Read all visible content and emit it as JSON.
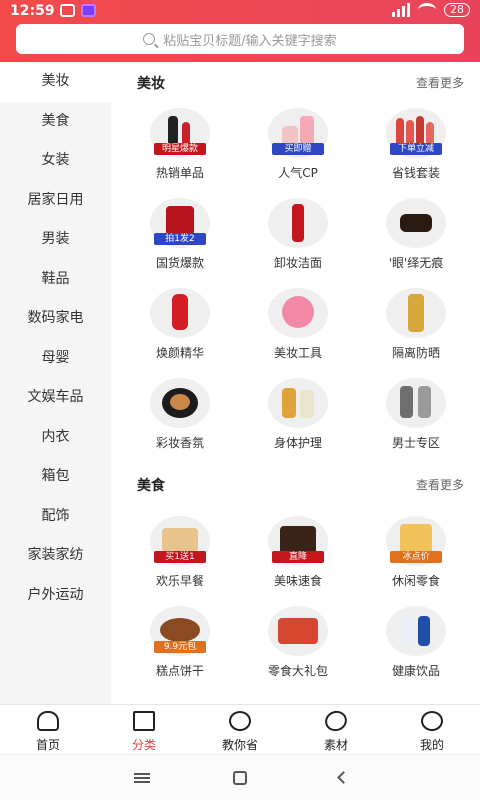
{
  "status": {
    "time": "12:59",
    "battery": "28"
  },
  "search": {
    "placeholder": "粘贴宝贝标题/输入关键字搜索"
  },
  "sidebar": {
    "items": [
      {
        "label": "美妆"
      },
      {
        "label": "美食"
      },
      {
        "label": "女装"
      },
      {
        "label": "居家日用"
      },
      {
        "label": "男装"
      },
      {
        "label": "鞋品"
      },
      {
        "label": "数码家电"
      },
      {
        "label": "母婴"
      },
      {
        "label": "文娱车品"
      },
      {
        "label": "内衣"
      },
      {
        "label": "箱包"
      },
      {
        "label": "配饰"
      },
      {
        "label": "家装家纺"
      },
      {
        "label": "户外运动"
      }
    ],
    "active": "美妆"
  },
  "sections": [
    {
      "title": "美妆",
      "more": "查看更多",
      "items": [
        {
          "label": "热销单品",
          "badge": "明星爆款",
          "icon": "lipstick-product-icon"
        },
        {
          "label": "人气CP",
          "badge": "买即赠",
          "icon": "skincare-bottles-icon"
        },
        {
          "label": "省钱套装",
          "badge": "下单立减",
          "icon": "skincare-set-icon"
        },
        {
          "label": "国货爆款",
          "badge": "拍1发2",
          "icon": "face-mask-icon"
        },
        {
          "label": "卸妆洁面",
          "badge": "",
          "icon": "cleanser-tube-icon"
        },
        {
          "label": "'眼'绎无痕",
          "badge": "",
          "icon": "eye-cream-jar-icon"
        },
        {
          "label": "焕颜精华",
          "badge": "",
          "icon": "serum-bottle-icon"
        },
        {
          "label": "美妆工具",
          "badge": "",
          "icon": "cleansing-brush-icon"
        },
        {
          "label": "隔离防晒",
          "badge": "",
          "icon": "sunscreen-bottle-icon"
        },
        {
          "label": "彩妆香氛",
          "badge": "",
          "icon": "cushion-compact-icon"
        },
        {
          "label": "身体护理",
          "badge": "",
          "icon": "body-lotion-icon"
        },
        {
          "label": "男士专区",
          "badge": "",
          "icon": "mens-skincare-icon"
        }
      ]
    },
    {
      "title": "美食",
      "more": "查看更多",
      "items": [
        {
          "label": "欢乐早餐",
          "badge": "买1送1",
          "icon": "bread-breakfast-icon"
        },
        {
          "label": "美味速食",
          "badge": "直降",
          "icon": "instant-food-icon"
        },
        {
          "label": "休闲零食",
          "badge": "冰点价",
          "icon": "snack-bag-icon"
        },
        {
          "label": "糕点饼干",
          "badge": "9.9元包",
          "icon": "cookie-tin-icon"
        },
        {
          "label": "零食大礼包",
          "badge": "",
          "icon": "snack-gift-box-icon"
        },
        {
          "label": "健康饮品",
          "badge": "",
          "icon": "milk-drink-icon"
        }
      ]
    }
  ],
  "tabbar": {
    "items": [
      {
        "label": "首页",
        "icon": "home-icon"
      },
      {
        "label": "分类",
        "icon": "category-grid-icon"
      },
      {
        "label": "教你省",
        "icon": "saver-icon"
      },
      {
        "label": "素材",
        "icon": "material-icon"
      },
      {
        "label": "我的",
        "icon": "profile-icon"
      }
    ],
    "active": "分类"
  },
  "colors": {
    "brand": "#e8455d",
    "badge_red": "#c4161c",
    "badge_blue": "#2f46c5",
    "badge_orange": "#e0701e"
  }
}
